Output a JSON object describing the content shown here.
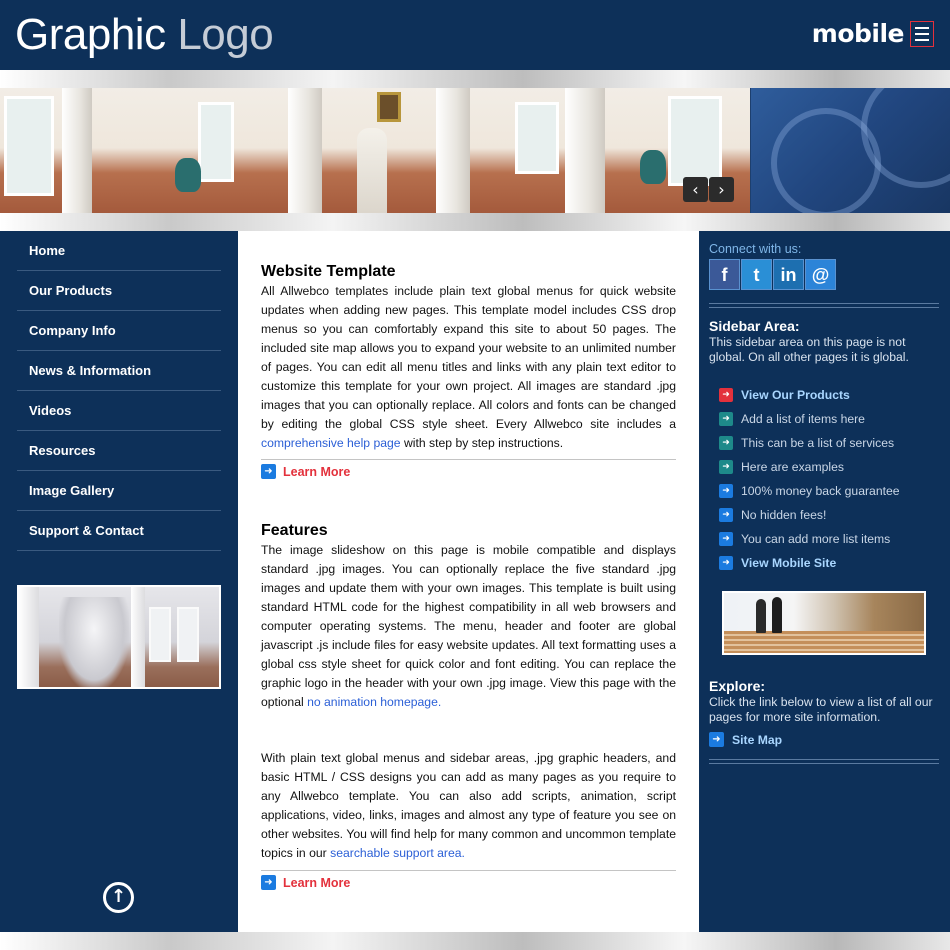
{
  "header": {
    "logo_part1": "Graphic",
    "logo_part2": "Logo",
    "mobile_label": "mobile",
    "menu_icon": "hamburger-icon"
  },
  "slideshow": {
    "prev_icon": "chevron-left-icon",
    "next_icon": "chevron-right-icon",
    "prev_glyph": "‹",
    "next_glyph": "›"
  },
  "nav": {
    "items": [
      {
        "label": "Home"
      },
      {
        "label": "Our Products"
      },
      {
        "label": "Company Info"
      },
      {
        "label": "News & Information"
      },
      {
        "label": "Videos"
      },
      {
        "label": "Resources"
      },
      {
        "label": "Image Gallery"
      },
      {
        "label": "Support & Contact"
      }
    ]
  },
  "scroll_top": {
    "icon": "arrow-up-icon",
    "glyph": "↑"
  },
  "main": {
    "section1": {
      "title": "Website Template",
      "text": "All Allwebco templates include plain text global menus for quick website updates when adding new pages. This template model includes CSS drop menus so you can comfortably expand this site to about 50 pages. The included site map allows you to expand your website to an unlimited number of pages. You can edit all menu titles and links with any plain text editor to customize this template for your own project. All images are standard .jpg images that you can optionally replace. All colors and fonts can be changed by editing the global CSS style sheet. Every Allwebco site includes a ",
      "link": "comprehensive help page",
      "text_after": " with step by step instructions.",
      "learn_more": "Learn More"
    },
    "section2": {
      "title": "Features",
      "text": "The image slideshow on this page is mobile compatible and displays standard .jpg images. You can optionally replace the five standard .jpg images and update them with your own images. This template is built using standard HTML code for the highest compatibility in all web browsers and computer operating systems. The menu, header and footer are global javascript .js include files for easy website updates. All text formatting uses a global css style sheet for quick color and font editing. You can replace the graphic logo in the header with your own .jpg image. View this page with the optional ",
      "link": "no animation homepage."
    },
    "section3": {
      "text": "With plain text global menus and sidebar areas, .jpg graphic headers, and basic HTML / CSS designs you can add as many pages as you require to any Allwebco template. You can also add scripts, animation, script applications, video, links, images and almost any type of feature you see on other websites. You will find help for many common and uncommon template topics in our ",
      "link": "searchable support area.",
      "learn_more": "Learn More"
    }
  },
  "sidebar": {
    "connect_label": "Connect with us:",
    "social": [
      {
        "icon": "facebook-icon",
        "glyph": "f"
      },
      {
        "icon": "twitter-icon",
        "glyph": "t"
      },
      {
        "icon": "linkedin-icon",
        "glyph": "in"
      },
      {
        "icon": "email-icon",
        "glyph": "@"
      }
    ],
    "area_title": "Sidebar Area:",
    "area_text": "This sidebar area on this page is not global. On all other pages it is global.",
    "list": [
      {
        "label": "View Our Products",
        "bold": true,
        "color": "#e3313c"
      },
      {
        "label": "Add a list of items here",
        "bold": false,
        "color": "#1e8a8a"
      },
      {
        "label": "This can be a list of services",
        "bold": false,
        "color": "#1e8a8a"
      },
      {
        "label": "Here are examples",
        "bold": false,
        "color": "#1e8a8a"
      },
      {
        "label": "100% money back guarantee",
        "bold": false,
        "color": "#1b7be0"
      },
      {
        "label": "No hidden fees!",
        "bold": false,
        "color": "#1b7be0"
      },
      {
        "label": "You can add more list items",
        "bold": false,
        "color": "#1b7be0"
      },
      {
        "label": "View Mobile Site",
        "bold": true,
        "color": "#1b7be0"
      }
    ],
    "explore_title": "Explore:",
    "explore_text": "Click the link below to view a list of all our pages for more site information.",
    "sitemap_label": "Site Map"
  },
  "colors": {
    "navy": "#0d3059",
    "accent_red": "#e3313c",
    "link_blue": "#2b5fd6",
    "icon_blue": "#1b7be0",
    "sidebar_link": "#a9d6ff"
  }
}
